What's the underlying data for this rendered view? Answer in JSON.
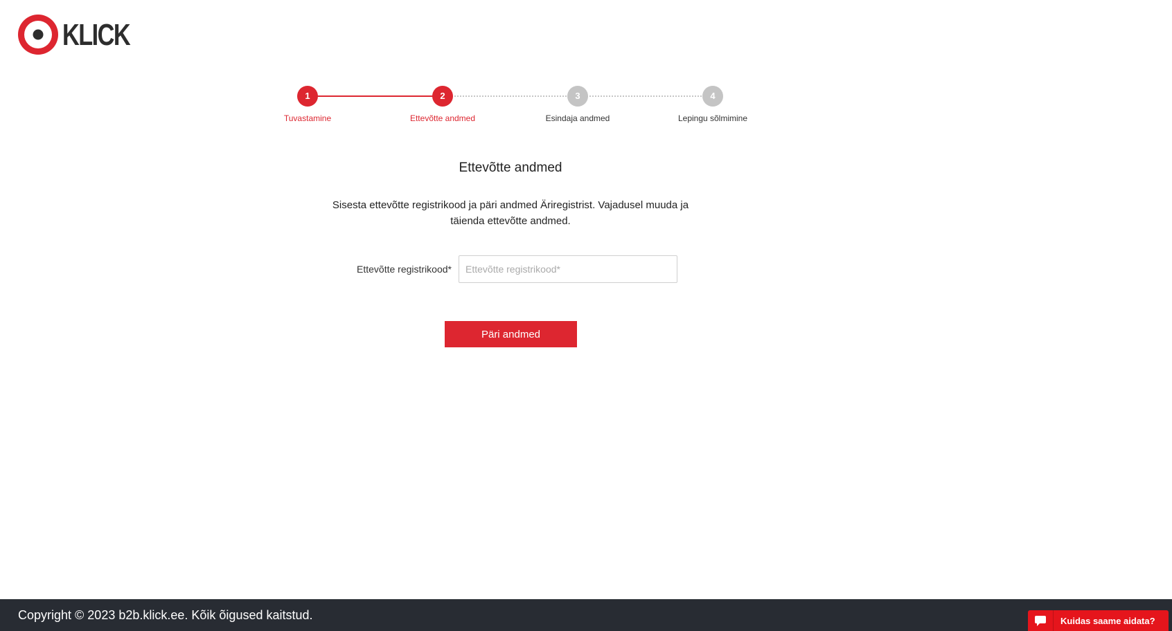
{
  "brand": {
    "name": "KLICK",
    "primary_color": "#dd2630",
    "logo_icon": "target-icon"
  },
  "stepper": {
    "steps": [
      {
        "number": "1",
        "label": "Tuvastamine",
        "state": "active"
      },
      {
        "number": "2",
        "label": "Ettevõtte andmed",
        "state": "active"
      },
      {
        "number": "3",
        "label": "Esindaja andmed",
        "state": "inactive"
      },
      {
        "number": "4",
        "label": "Lepingu sõlmimine",
        "state": "inactive"
      }
    ],
    "current_step": 2
  },
  "main": {
    "title": "Ettevõtte andmed",
    "description": "Sisesta ettevõtte registrikood ja päri andmed Äriregistrist. Vajadusel muuda ja täienda ettevõtte andmed.",
    "form": {
      "registry_code_label": "Ettevõtte registrikood*",
      "registry_code_placeholder": "Ettevõtte registrikood*",
      "registry_code_value": ""
    },
    "submit_label": "Päri andmed"
  },
  "footer": {
    "copyright": "Copyright © 2023 b2b.klick.ee. Kõik õigused kaitstud.",
    "background_color": "#282c33"
  },
  "chat": {
    "label": "Kuidas saame aidata?",
    "icon": "chat-bubble-icon",
    "color": "#e5151c"
  }
}
